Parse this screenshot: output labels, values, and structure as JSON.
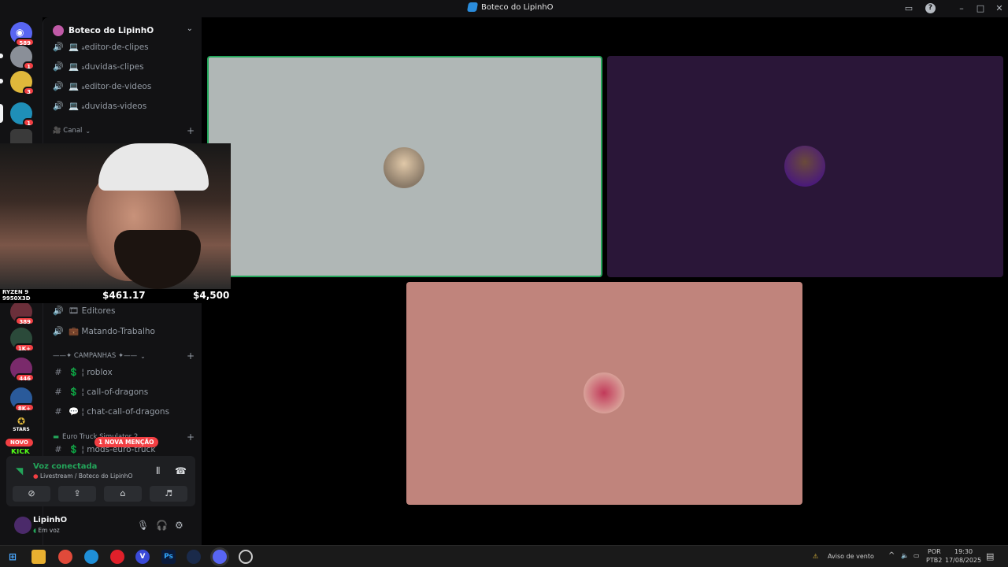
{
  "window": {
    "title": "Boteco do LipinhO",
    "accent": "#2a8cdb"
  },
  "rail": {
    "badges": [
      "589",
      "1",
      "3",
      "1",
      "389",
      "1K+",
      "446",
      "8K+"
    ],
    "stars_label": "STARS",
    "novo_label": "NOVO",
    "kick_label": "KICK"
  },
  "guild": {
    "name": "Boteco do LipinhO"
  },
  "channels_top": [
    {
      "label": "💻 ₐeditor-de-clipes"
    },
    {
      "label": "💻 ₐduvidas-clipes"
    },
    {
      "label": "💻 ₐeditor-de-videos"
    },
    {
      "label": "💻 ₐduvidas-videos"
    }
  ],
  "categories": {
    "canal": "🎥 Canal",
    "campanhas": "——✦ CAMPANHAS ✦——",
    "euro": "Euro Truck Simulator 2"
  },
  "channels_mid": [
    {
      "label": "🎞 Editores"
    },
    {
      "label": "💼 Matando-Trabalho"
    }
  ],
  "channels_campanhas": [
    {
      "label": "💲 ¦ roblox"
    },
    {
      "label": "💲 ¦ call-of-dragons"
    },
    {
      "label": "💬 ¦ chat-call-of-dragons"
    },
    {
      "label": "💲 ¦ mods-euro-truck"
    }
  ],
  "mention_pill": "1 NOVA MENÇÃO",
  "voice": {
    "status": "Voz conectada",
    "channel": "Livestream / Boteco do LipinhO"
  },
  "user": {
    "name": "LipinhO",
    "status": "Em voz"
  },
  "overlay": {
    "cpu_line1": "RYZEN 9",
    "cpu_line2": "9950X3D",
    "value1": "$461.17",
    "value2": "$4,500"
  },
  "tiles": [
    {
      "name": "tile-user-1",
      "bg": "#b0b7b6",
      "speaking": true
    },
    {
      "name": "tile-user-2",
      "bg": "#2a1638",
      "speaking": false
    },
    {
      "name": "tile-user-3",
      "bg": "#c0847c",
      "speaking": false
    }
  ],
  "taskbar": {
    "weather": "Aviso de vento",
    "lang1": "POR",
    "lang2": "PTB2",
    "time": "19:30",
    "date": "17/08/2025"
  }
}
